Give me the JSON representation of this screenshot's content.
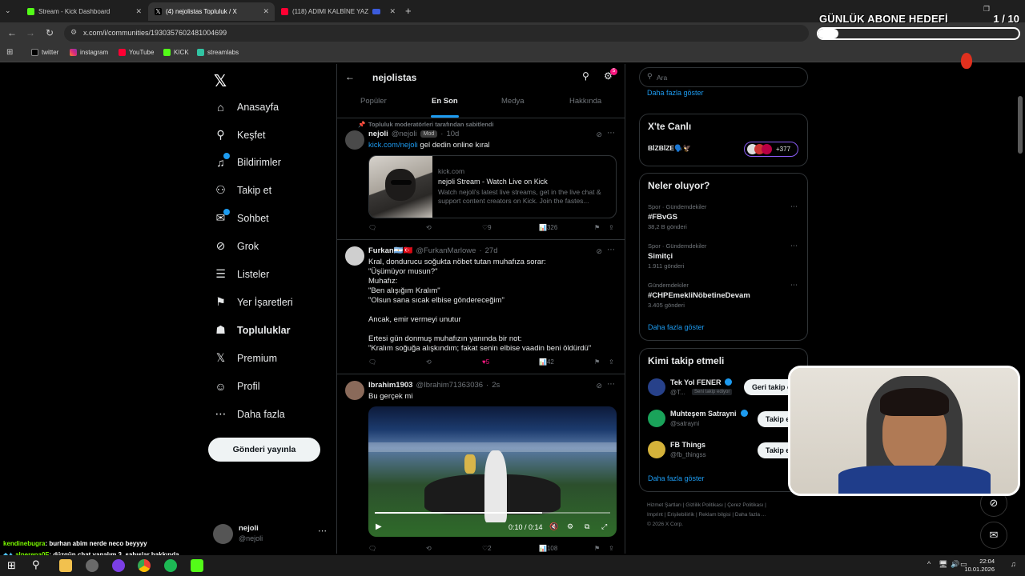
{
  "browser": {
    "tabs": [
      {
        "title": "Stream - Kick Dashboard",
        "active": false
      },
      {
        "title": "(4) nejolistas Topluluk / X",
        "active": true
      },
      {
        "title": "(118) ADIMI KALBİNE YAZ",
        "active": false
      }
    ],
    "url": "x.com/i/communities/1930357602481004699",
    "bookmarks": [
      "twitter",
      "instagram",
      "YouTube",
      "KICK",
      "streamlabs"
    ]
  },
  "goal_overlay": {
    "title": "GÜNLÜK ABONE HEDEFİ",
    "count": "1 / 10",
    "progress": 0.1
  },
  "nav": {
    "items": [
      {
        "label": "Anasayfa",
        "icon": "home-icon"
      },
      {
        "label": "Keşfet",
        "icon": "search-icon"
      },
      {
        "label": "Bildirimler",
        "icon": "bell-icon"
      },
      {
        "label": "Takip et",
        "icon": "add-person-icon"
      },
      {
        "label": "Sohbet",
        "icon": "mail-icon"
      },
      {
        "label": "Grok",
        "icon": "grok-icon"
      },
      {
        "label": "Listeler",
        "icon": "list-icon"
      },
      {
        "label": "Yer İşaretleri",
        "icon": "bookmark-icon"
      },
      {
        "label": "Topluluklar",
        "icon": "communities-icon"
      },
      {
        "label": "Premium",
        "icon": "x-logo-icon"
      },
      {
        "label": "Profil",
        "icon": "person-icon"
      },
      {
        "label": "Daha fazla",
        "icon": "more-circle-icon"
      }
    ],
    "post_button": "Gönderi yayınla",
    "account": {
      "name": "nejoli",
      "handle": "@nejoli"
    }
  },
  "community": {
    "name": "nejolistas",
    "settings_badge": "5",
    "tabs": [
      "Popüler",
      "En Son",
      "Medya",
      "Hakkında"
    ],
    "active_tab": "En Son"
  },
  "tweets": [
    {
      "pinned_label": "Topluluk moderatörleri tarafından sabitlendi",
      "name": "nejoli",
      "handle": "@nejoli",
      "badge": "Mod",
      "time": "10d",
      "link_text": "kick.com/nejoli",
      "text": " gel dedin online kıral",
      "card": {
        "domain": "kick.com",
        "title": "nejoli Stream - Watch Live on Kick",
        "desc": "Watch nejoli's latest live streams, get in the live chat & support content creators on Kick. Join the fastes..."
      },
      "likes": "9",
      "views": "326"
    },
    {
      "name": "Furkan🇦🇷🇹🇷",
      "handle": "@FurkanMarlowe",
      "time": "27d",
      "text": "Kral, dondurucu soğukta nöbet tutan muhafıza sorar:\n\"Üşümüyor musun?\"\nMuhafız:\n\"Ben alışığım Kralım\"\n\"Olsun sana sıcak elbise göndereceğim\"\n\nAncak, emir vermeyi unutur\n\nErtesi gün donmuş muhafızın yanında bir not:\n\"Kralım soğuğa alışkındım; fakat senin elbise vaadin beni öldürdü\"",
      "likes": "5",
      "views": "42"
    },
    {
      "name": "Ibrahim1903",
      "handle": "@Ibrahim71363036",
      "time": "2s",
      "text": "Bu gerçek mi",
      "video_time": "0:10 / 0:14",
      "likes": "2",
      "views": "108"
    }
  ],
  "right": {
    "search_placeholder": "Ara",
    "show_more": "Daha fazla göster",
    "live": {
      "title": "X'te Canlı",
      "name": "BİZBİZE🗣️🦅",
      "count": "+377"
    },
    "trends_title": "Neler oluyor?",
    "trends": [
      {
        "meta": "Spor · Gündemdekiler",
        "name": "#FBvGS",
        "posts": "38,2 B gönderi"
      },
      {
        "meta": "Spor · Gündemdekiler",
        "name": "Simitçi",
        "posts": "1.911 gönderi"
      },
      {
        "meta": "Gündemdekiler",
        "name": "#CHPEmekliNöbetineDevam",
        "posts": "3.405 gönderi"
      }
    ],
    "who_title": "Kimi takip etmeli",
    "who": [
      {
        "name": "Tek Yol FENER",
        "handle": "@T...",
        "tag": "Seni takip ediyor",
        "button": "Geri takip et"
      },
      {
        "name": "Muhteşem Satrayni",
        "handle": "@satrayni",
        "button": "Takip et"
      },
      {
        "name": "FB Things",
        "handle": "@fb_thingss",
        "button": "Takip et"
      }
    ],
    "footer": [
      "Hizmet Şartları",
      "Gizlilik Politikası",
      "Çerez Politikası",
      "Imprint",
      "Erişilebilirlik",
      "Reklam bilgisi",
      "Daha fazla ...",
      "© 2026 X Corp."
    ]
  },
  "chat": [
    {
      "user": "kendinebugra",
      "msg": ": burhan abim nerde neco beyyyy",
      "color": "#7CFC00"
    },
    {
      "user": "alperena0F",
      "msg": ": düzgün chat yapalım 3. şahıslar hakkında",
      "color": "#7CFC00"
    }
  ],
  "taskbar": {
    "time": "22:04",
    "date": "10.01.2026"
  }
}
